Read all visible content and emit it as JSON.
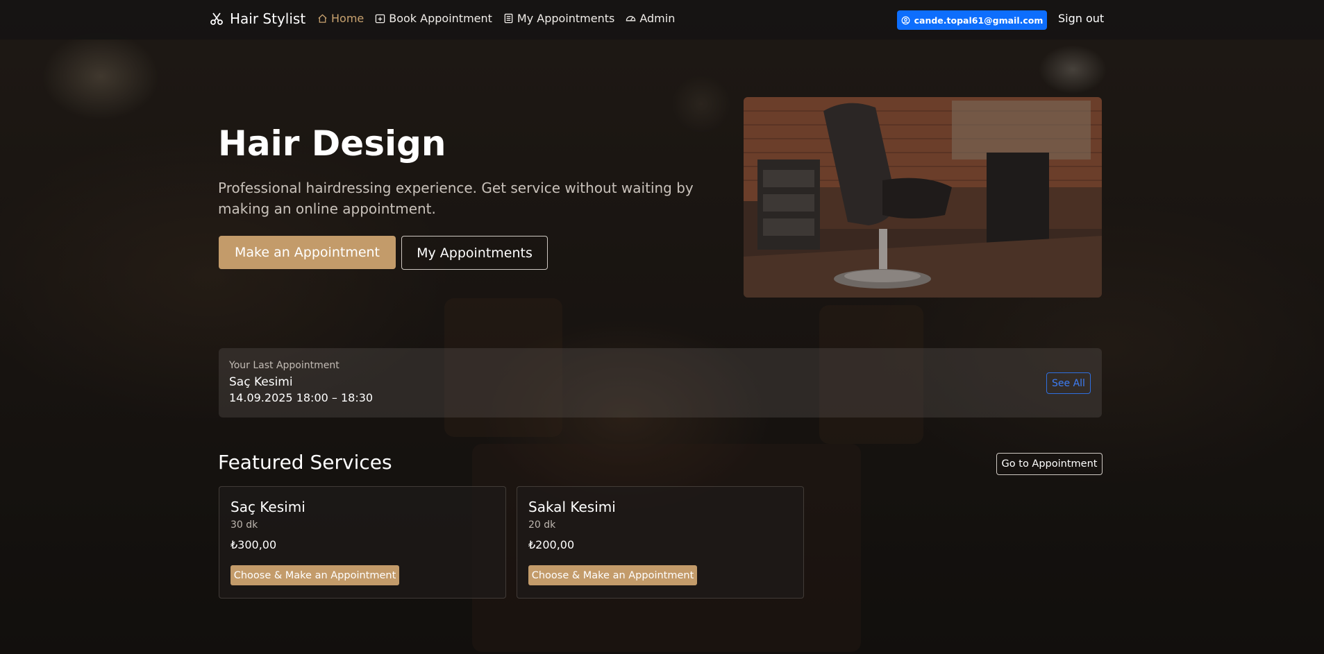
{
  "nav": {
    "brand": "Hair Stylist",
    "items": [
      {
        "label": "Home",
        "icon": "home-icon",
        "active": true
      },
      {
        "label": "Book Appointment",
        "icon": "calendar-plus-icon",
        "active": false
      },
      {
        "label": "My Appointments",
        "icon": "list-document-icon",
        "active": false
      },
      {
        "label": "Admin",
        "icon": "speedometer-icon",
        "active": false
      }
    ],
    "user_email": "cande.topal61@gmail.com",
    "signout": "Sign out"
  },
  "hero": {
    "title": "Hair Design",
    "subtitle": "Professional hairdressing experience. Get service without waiting by making an online appointment.",
    "primary_button": "Make an Appointment",
    "secondary_button": "My Appointments"
  },
  "last_appointment": {
    "label": "Your Last Appointment",
    "service": "Saç Kesimi",
    "time": "14.09.2025 18:00 – 18:30",
    "see_all": "See All"
  },
  "featured": {
    "title": "Featured Services",
    "goto_button": "Go to Appointment",
    "services": [
      {
        "name": "Saç Kesimi",
        "duration": "30 dk",
        "price": "₺300,00",
        "button": "Choose & Make an Appointment"
      },
      {
        "name": "Sakal Kesimi",
        "duration": "20 dk",
        "price": "₺200,00",
        "button": "Choose & Make an Appointment"
      }
    ]
  },
  "colors": {
    "accent": "#c39b6a",
    "primary_blue": "#0d6efd",
    "background": "#1a1614"
  }
}
